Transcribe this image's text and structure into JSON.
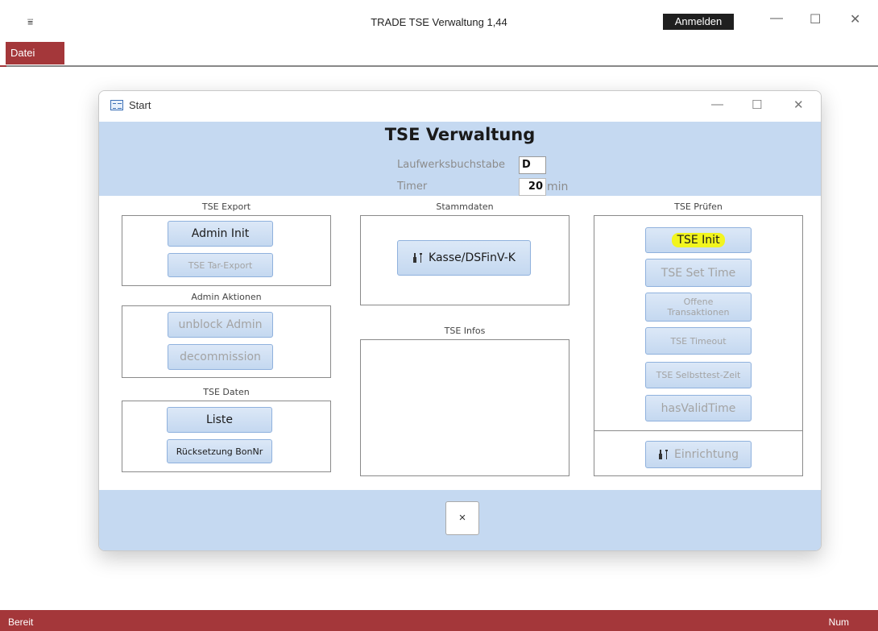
{
  "app": {
    "title": "TRADE TSE Verwaltung 1,44",
    "quick_access_icon": "⩸",
    "signin_label": "Anmelden",
    "minimize_glyph": "—",
    "maximize_glyph": "☐",
    "close_glyph": "✕"
  },
  "ribbon": {
    "file_tab": "Datei"
  },
  "form": {
    "window_title": "Start",
    "minimize_glyph": "—",
    "maximize_glyph": "☐",
    "close_glyph": "✕",
    "heading": "TSE Verwaltung",
    "drive_label": "Laufwerksbuchstabe",
    "drive_value": "D",
    "timer_label": "Timer",
    "timer_value": "20",
    "timer_unit": "min"
  },
  "export_section": {
    "label": "TSE Export",
    "admin_init": "Admin Init",
    "tar_export": "TSE Tar-Export"
  },
  "admin_section": {
    "label": "Admin Aktionen",
    "unblock": "unblock Admin",
    "decommission": "decommission"
  },
  "data_section": {
    "label": "TSE Daten",
    "list": "Liste",
    "reset_bon": "Rücksetzung BonNr"
  },
  "master_section": {
    "label": "Stammdaten",
    "register": "Kasse/DSFinV-K",
    "register_icon": "tools-icon"
  },
  "info_section": {
    "label": "TSE Infos"
  },
  "check_section": {
    "label": "TSE Prüfen",
    "init": "TSE Init",
    "set_time": "TSE Set Time",
    "open_tx_line1": "Offene",
    "open_tx_line2": "Transaktionen",
    "timeout": "TSE Timeout",
    "selftest": "TSE Selbsttest-Zeit",
    "valid_time": "hasValidTime",
    "setup": "Einrichtung",
    "setup_icon": "tools-icon"
  },
  "footer": {
    "close_glyph": "×"
  },
  "status": {
    "left": "Bereit",
    "right": "Num"
  },
  "colors": {
    "accent": "#a4373a",
    "header_band": "#c5d9f1",
    "button": "#c4d8f0",
    "highlight": "#f2f51f"
  }
}
